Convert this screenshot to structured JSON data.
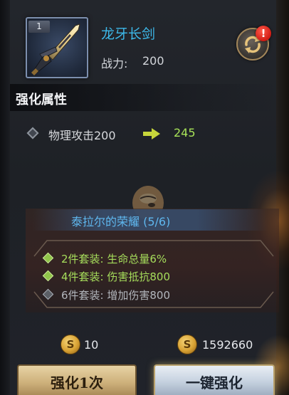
{
  "item": {
    "level": "1",
    "name": "龙牙长剑",
    "power_label": "战力:",
    "power_value": "200",
    "icon": "sword-icon",
    "alert_badge": "!"
  },
  "section": {
    "title": "强化属性"
  },
  "stat": {
    "label": "物理攻击200",
    "new_value": "245",
    "arrow_icon": "right-arrow-icon"
  },
  "set": {
    "name": "泰拉尔的荣耀 (5/6)",
    "bonuses": [
      {
        "text": "2件套装: 生命总量6%",
        "active": true
      },
      {
        "text": "4件套装: 伤害抵抗800",
        "active": true
      },
      {
        "text": "6件套装: 增加伤害800",
        "active": false
      }
    ]
  },
  "costs": {
    "coin_symbol": "S",
    "single": "10",
    "all": "1592660"
  },
  "buttons": {
    "enhance_once": "强化1次",
    "enhance_all": "一键强化"
  },
  "colors": {
    "item_name": "#3db9ea",
    "stat_new": "#a7e258",
    "set_name": "#5fb7ee",
    "bonus_active": "#a6dd5b",
    "bonus_inactive": "#b2b6bc"
  }
}
